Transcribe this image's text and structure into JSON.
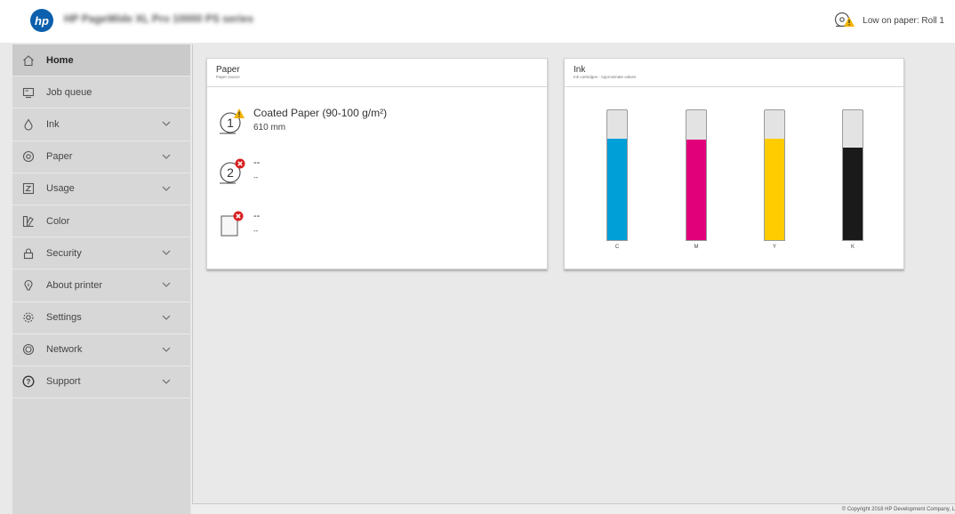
{
  "header": {
    "logo_text": "hp",
    "printer_name": "HP PageWide XL Pro 10000 PS series",
    "alert_text": "Low on paper: Roll 1",
    "alert_icon": "paper-roll-warning-icon"
  },
  "sidebar": {
    "items": [
      {
        "label": "Home",
        "icon": "home-icon",
        "active": true,
        "expandable": false
      },
      {
        "label": "Job queue",
        "icon": "job-queue-icon",
        "active": false,
        "expandable": false
      },
      {
        "label": "Ink",
        "icon": "ink-drop-icon",
        "active": false,
        "expandable": true
      },
      {
        "label": "Paper",
        "icon": "paper-roll-icon",
        "active": false,
        "expandable": true
      },
      {
        "label": "Usage",
        "icon": "usage-icon",
        "active": false,
        "expandable": true
      },
      {
        "label": "Color",
        "icon": "color-swatch-icon",
        "active": false,
        "expandable": false
      },
      {
        "label": "Security",
        "icon": "lock-icon",
        "active": false,
        "expandable": true
      },
      {
        "label": "About printer",
        "icon": "info-icon",
        "active": false,
        "expandable": true
      },
      {
        "label": "Settings",
        "icon": "gear-icon",
        "active": false,
        "expandable": true
      },
      {
        "label": "Network",
        "icon": "globe-icon",
        "active": false,
        "expandable": true
      },
      {
        "label": "Support",
        "icon": "help-icon",
        "active": false,
        "expandable": true
      }
    ]
  },
  "paper_card": {
    "title": "Paper",
    "subtitle": "Paper source",
    "sources": [
      {
        "number": "1",
        "name": "Coated Paper (90-100 g/m²)",
        "detail": "610 mm",
        "status": "warning"
      },
      {
        "number": "2",
        "name": "--",
        "detail": "--",
        "status": "error"
      },
      {
        "number": "",
        "name": "--",
        "detail": "--",
        "status": "error"
      }
    ]
  },
  "ink_card": {
    "title": "Ink",
    "subtitle": "Ink cartridges - Approximate values",
    "cartridges": [
      {
        "label": "C",
        "level": 0.9,
        "color": "#009fd8"
      },
      {
        "label": "M",
        "level": 0.89,
        "color": "#e1007a"
      },
      {
        "label": "Y",
        "level": 0.9,
        "color": "#ffcc00"
      },
      {
        "label": "K",
        "level": 0.82,
        "color": "#1a1a1a"
      }
    ]
  },
  "footer": {
    "copyright": "© Copyright 2018 HP Development Company, L"
  },
  "colors": {
    "warning": "#f2b300",
    "error": "#d81e1e",
    "brand": "#0b5fad"
  }
}
